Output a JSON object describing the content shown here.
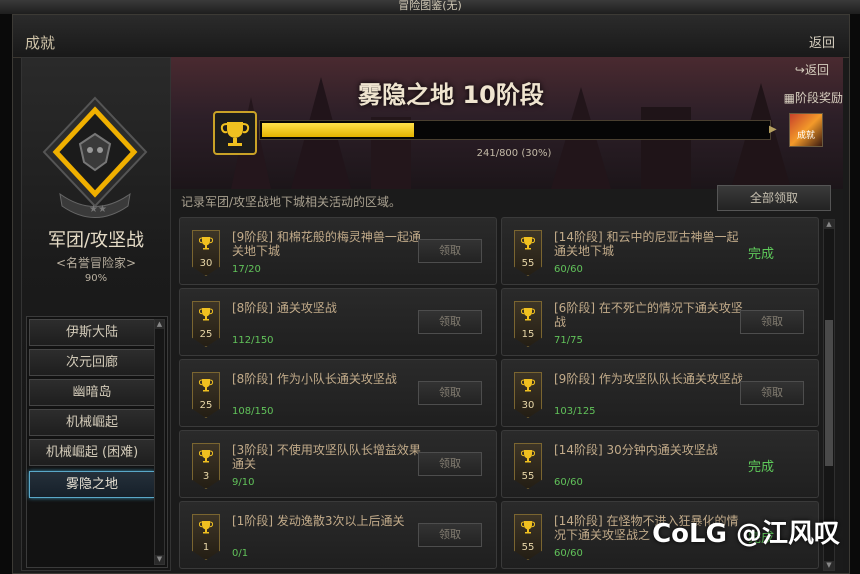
{
  "window": {
    "title": "冒险图鉴(无)"
  },
  "header": {
    "title": "成就",
    "back_label": "返回"
  },
  "left": {
    "category_title": "军团/攻坚战",
    "category_subtitle": "<名誉冒险家>",
    "category_percent": "90%",
    "nav_items": [
      {
        "label": "伊斯大陆"
      },
      {
        "label": "次元回廊"
      },
      {
        "label": "幽暗岛"
      },
      {
        "label": "机械崛起"
      },
      {
        "label": "机械崛起 (困难)"
      },
      {
        "label": "雾隐之地"
      }
    ],
    "selected_index": 5
  },
  "region": {
    "title": "雾隐之地  10阶段",
    "back_label": "返回",
    "stage_reward_label": "阶段奖励",
    "progress_text": "241/800 (30%)",
    "progress_fraction": 0.3,
    "reward_icon_text": "成就",
    "description": "记录军团/攻坚战地下城相关活动的区域。",
    "claim_all_label": "全部领取"
  },
  "achievements": [
    {
      "points": "30",
      "title": "[9阶段] 和棉花般的梅灵神兽一起通关地下城",
      "progress": "17/20",
      "action": "领取",
      "done": false
    },
    {
      "points": "55",
      "title": "[14阶段] 和云中的尼亚古神兽一起通关地下城",
      "progress": "60/60",
      "action": "完成",
      "done": true
    },
    {
      "points": "25",
      "title": "[8阶段] 通关攻坚战",
      "progress": "112/150",
      "action": "领取",
      "done": false
    },
    {
      "points": "15",
      "title": "[6阶段] 在不死亡的情况下通关攻坚战",
      "progress": "71/75",
      "action": "领取",
      "done": false
    },
    {
      "points": "25",
      "title": "[8阶段] 作为小队长通关攻坚战",
      "progress": "108/150",
      "action": "领取",
      "done": false
    },
    {
      "points": "30",
      "title": "[9阶段] 作为攻坚队队长通关攻坚战",
      "progress": "103/125",
      "action": "领取",
      "done": false
    },
    {
      "points": "3",
      "title": "[3阶段] 不使用攻坚队队长增益效果通关",
      "progress": "9/10",
      "action": "领取",
      "done": false
    },
    {
      "points": "55",
      "title": "[14阶段] 30分钟内通关攻坚战",
      "progress": "60/60",
      "action": "完成",
      "done": true
    },
    {
      "points": "1",
      "title": "[1阶段] 发动逸散3次以上后通关",
      "progress": "0/1",
      "action": "领取",
      "done": false
    },
    {
      "points": "55",
      "title": "[14阶段] 在怪物不进入狂暴化的情况下通关攻坚战之",
      "progress": "60/60",
      "action": "完成",
      "done": true
    }
  ],
  "watermark": "CoLG @江风叹",
  "colors": {
    "accent_gold": "#e3b200",
    "done_green": "#5ec95a",
    "progress_green": "#61c25a",
    "selected_border": "#5aa8c8"
  }
}
